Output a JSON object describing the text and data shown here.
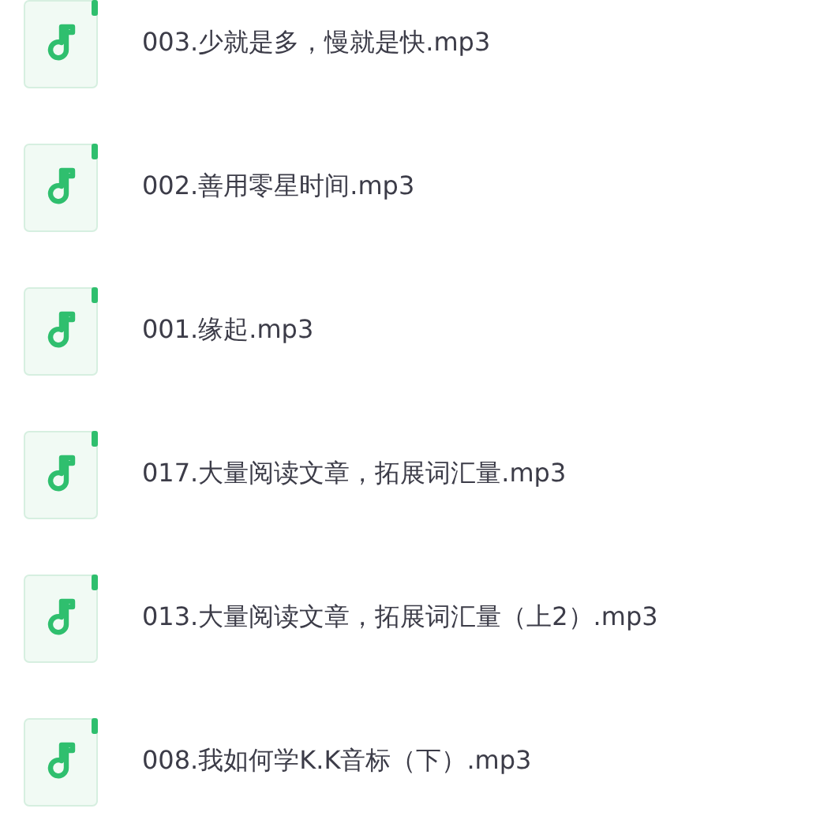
{
  "files": [
    {
      "name": "003.少就是多，慢就是快.mp3"
    },
    {
      "name": "002.善用零星时间.mp3"
    },
    {
      "name": "001.缘起.mp3"
    },
    {
      "name": "017.大量阅读文章，拓展词汇量.mp3"
    },
    {
      "name": "013.大量阅读文章，拓展词汇量（上2）.mp3"
    },
    {
      "name": "008.我如何学K.K音标（下）.mp3"
    }
  ]
}
